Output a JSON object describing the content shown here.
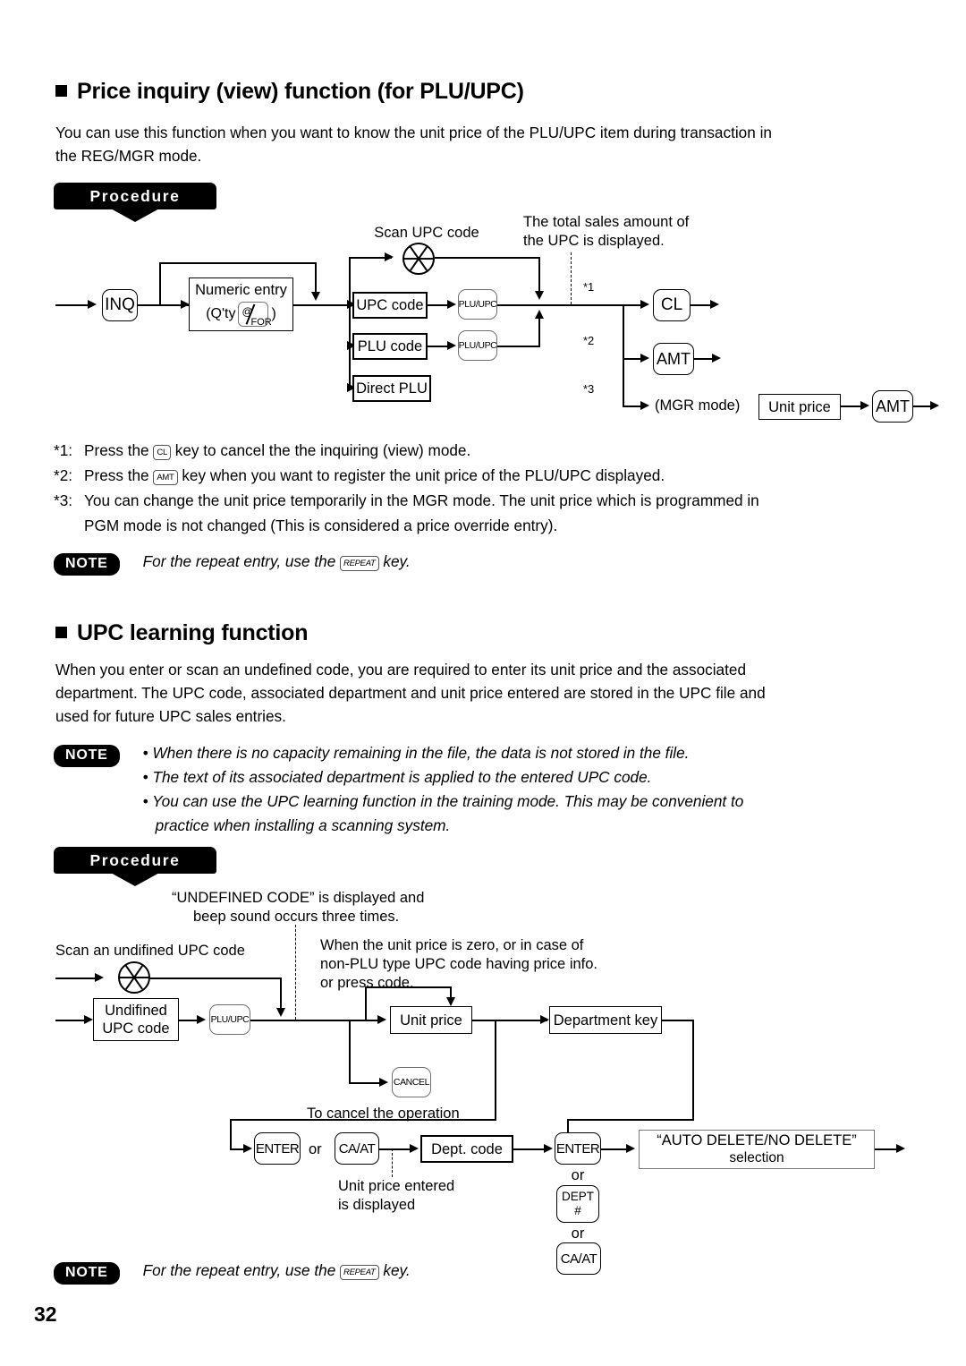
{
  "page": {
    "number": "32"
  },
  "section1": {
    "heading": "Price inquiry (view) function (for PLU/UPC)",
    "body_line1": "You can use this function when you want to know the unit price of the PLU/UPC item during transaction in",
    "body_line2": "the REG/MGR mode.",
    "procedure_label": "Procedure",
    "diagram": {
      "caption_scan": "Scan UPC code",
      "caption_total_line1": "The total sales amount of",
      "caption_total_line2": "the UPC is displayed.",
      "key_inq": "INQ",
      "box_numeric_line1": "Numeric entry",
      "box_numeric_qty": "(Q'ty",
      "box_numeric_close": ")",
      "key_atfor_at": "@",
      "key_atfor_for": "FOR",
      "box_upc_code": "UPC code",
      "box_plu_code": "PLU code",
      "box_direct_plu": "Direct PLU",
      "key_pluupc_1": "PLU/UPC",
      "key_pluupc_2": "PLU/UPC",
      "mark_1": "*1",
      "mark_2": "*2",
      "mark_3": "*3",
      "key_cl": "CL",
      "key_amt_1": "AMT",
      "label_mgr_mode": "(MGR mode)",
      "box_unit_price": "Unit price",
      "key_amt_2": "AMT"
    },
    "footnotes": [
      {
        "mark": "*1:",
        "before": "Press the",
        "key": "CL",
        "after": "key to cancel the the inquiring (view) mode."
      },
      {
        "mark": "*2:",
        "before": "Press the",
        "key": "AMT",
        "after": "key when you want to register the unit price of the PLU/UPC displayed."
      },
      {
        "mark": "*3:",
        "before": "You can change the unit price temporarily in the MGR mode.  The unit price which is programmed in",
        "key": "",
        "after": "PGM mode is not changed (This is considered a price override entry)."
      }
    ],
    "note": {
      "badge": "NOTE",
      "before": "For the repeat entry, use the",
      "key": "REPEAT",
      "after": "key."
    }
  },
  "section2": {
    "heading": "UPC learning function",
    "body_line1": "When you enter or scan an undefined code, you are required to enter its unit price and the associated",
    "body_line2": "department.  The UPC code, associated department and unit price entered are stored in the UPC file and",
    "body_line3": "used for future UPC sales entries.",
    "note": {
      "badge": "NOTE",
      "items": [
        "• When there is no capacity remaining in the file, the data is not stored in the file.",
        "• The text of its associated department is applied to the entered UPC code.",
        "• You can use the UPC learning function in the training mode.  This may be convenient to",
        "practice when installing a scanning system."
      ]
    },
    "procedure_label": "Procedure",
    "diagram": {
      "caption_undef_line1": "“UNDEFINED CODE” is displayed and",
      "caption_undef_line2": "beep sound occurs three times.",
      "caption_scan": "Scan an undifined UPC code",
      "caption_when_line1": "When the unit price is zero, or in case of",
      "caption_when_line2": "non-PLU type UPC code having price info.",
      "caption_when_line3": "or press code.",
      "box_undef_line1": "Undifined",
      "box_undef_line2": "UPC code",
      "key_pluupc": "PLU/UPC",
      "box_unit_price": "Unit price",
      "box_department_key": "Department key",
      "key_cancel": "CANCEL",
      "caption_cancel": "To cancel the operation",
      "key_enter_1": "ENTER",
      "or_1": "or",
      "key_caat_1": "CA/AT",
      "box_dept_code": "Dept. code",
      "key_enter_2": "ENTER",
      "or_2": "or",
      "key_dept_line1": "DEPT",
      "key_dept_line2": "#",
      "or_3": "or",
      "key_caat_2": "CA/AT",
      "caption_unitprice_line1": "Unit price entered",
      "caption_unitprice_line2": "is displayed",
      "box_auto_delete_line1": "“AUTO DELETE/NO DELETE”",
      "box_auto_delete_line2": "selection"
    },
    "note_bottom": {
      "badge": "NOTE",
      "before": "For the repeat entry, use the",
      "key": "REPEAT",
      "after": "key."
    }
  }
}
